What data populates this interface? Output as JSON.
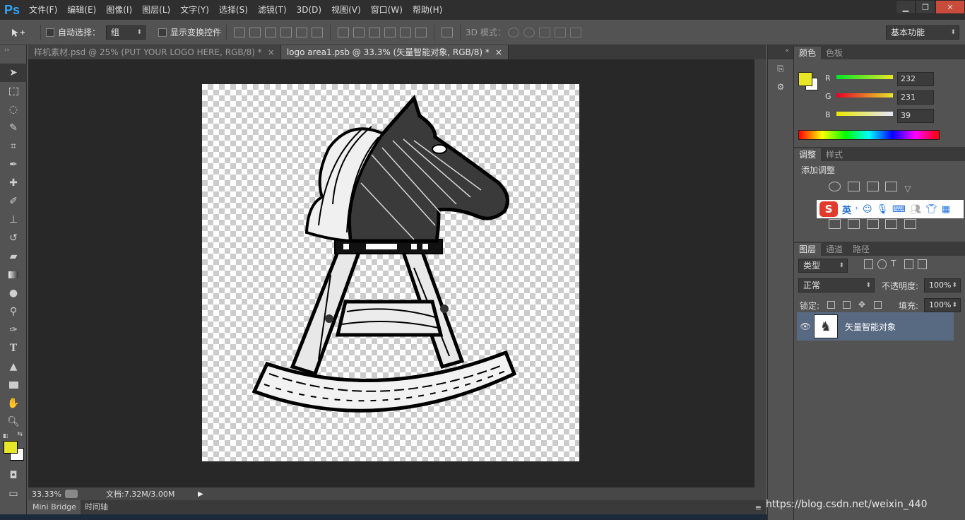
{
  "app": {
    "logo": "Ps"
  },
  "menu": [
    "文件(F)",
    "编辑(E)",
    "图像(I)",
    "图层(L)",
    "文字(Y)",
    "选择(S)",
    "滤镜(T)",
    "3D(D)",
    "视图(V)",
    "窗口(W)",
    "帮助(H)"
  ],
  "window_controls": {
    "minimize": "▁",
    "restore": "❐",
    "close": "✕"
  },
  "options": {
    "auto_select_label": "自动选择：",
    "auto_select_value": "组",
    "show_transform_label": "显示变换控件",
    "mode3d_label": "3D 模式：",
    "workspace": "基本功能"
  },
  "tabs": [
    {
      "label": "样机素材.psd @ 25% (PUT YOUR LOGO HERE, RGB/8) *",
      "close": "×"
    },
    {
      "label": "logo area1.psb @ 33.3% (矢量智能对象, RGB/8) *",
      "close": "×"
    }
  ],
  "status": {
    "zoom": "33.33%",
    "doc": "文档:7.32M/3.00M"
  },
  "bottom_tabs": [
    "Mini Bridge",
    "时间轴"
  ],
  "color_panel": {
    "tabs": [
      "颜色",
      "色板"
    ],
    "r_label": "R",
    "g_label": "G",
    "b_label": "B",
    "r": "232",
    "g": "231",
    "b": "39",
    "foreground": "#e8e727"
  },
  "adjust_panel": {
    "tabs": [
      "调整",
      "样式"
    ],
    "title": "添加调整"
  },
  "ime": {
    "mode": "英",
    "logo": "S"
  },
  "layers_panel": {
    "tabs": [
      "图层",
      "通道",
      "路径"
    ],
    "filter": "类型",
    "blend": "正常",
    "opacity_label": "不透明度:",
    "opacity": "100%",
    "lock_label": "锁定:",
    "fill_label": "填充:",
    "fill": "100%",
    "layer_name": "矢量智能对象"
  },
  "watermark": "https://blog.csdn.net/weixin_440"
}
